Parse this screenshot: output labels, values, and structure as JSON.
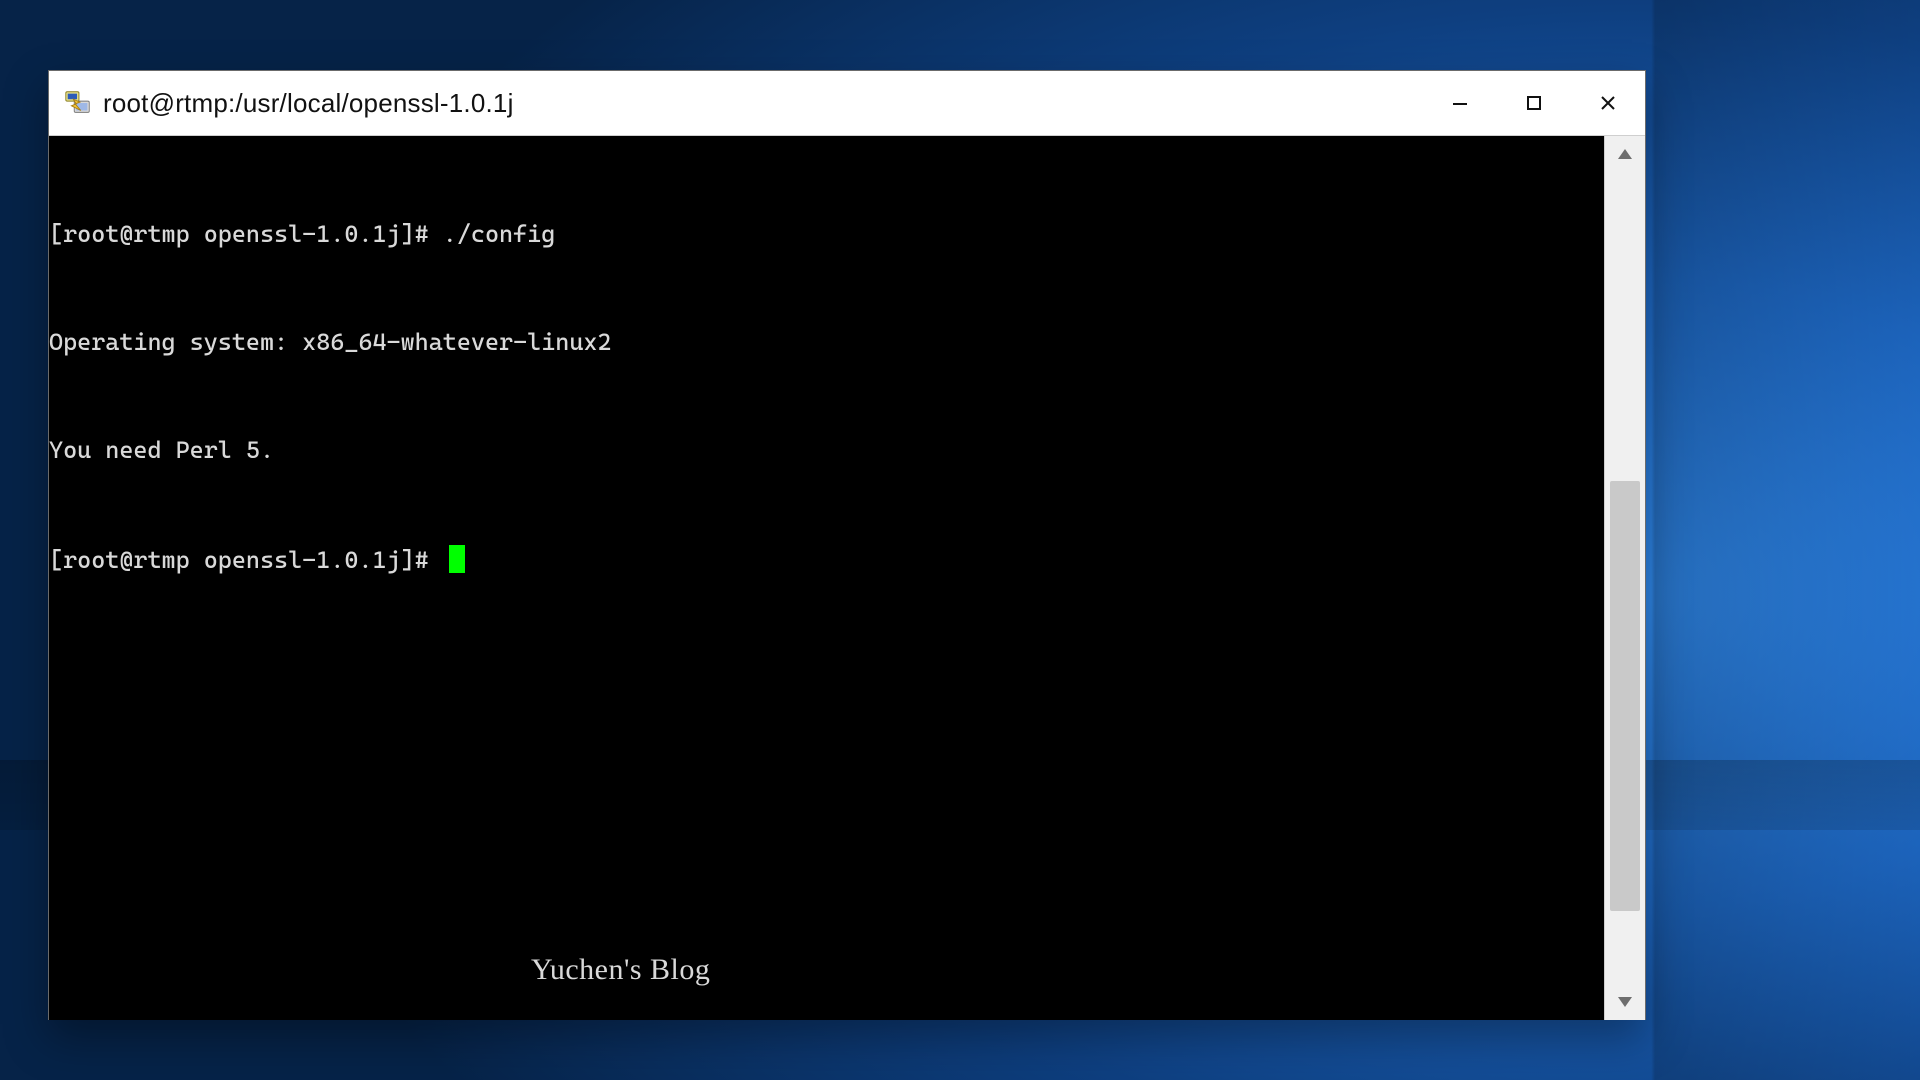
{
  "window": {
    "title": "root@rtmp:/usr/local/openssl-1.0.1j",
    "icon_name": "putty-icon"
  },
  "terminal": {
    "lines": [
      "[root@rtmp openssl-1.0.1j]# ./config",
      "Operating system: x86_64-whatever-linux2",
      "You need Perl 5.",
      "[root@rtmp openssl-1.0.1j]# "
    ],
    "prompt": "[root@rtmp openssl-1.0.1j]# ",
    "command": "./config",
    "output": [
      "Operating system: x86_64-whatever-linux2",
      "You need Perl 5."
    ],
    "cursor_color": "#00ff00"
  },
  "watermark": {
    "text": "Yuchen's Blog"
  },
  "scrollbar": {
    "up_label": "▲",
    "down_label": "▼"
  },
  "window_controls": {
    "minimize": "—",
    "maximize": "▢",
    "close": "✕"
  }
}
